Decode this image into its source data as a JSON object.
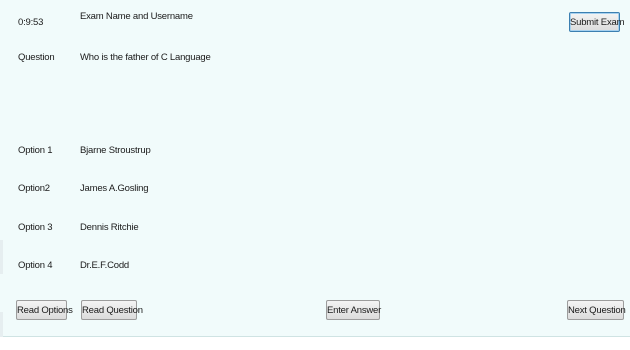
{
  "timer": "0:9:53",
  "header": {
    "exam_name": "Exam Name and Username",
    "submit_label": "Submit Exam"
  },
  "question": {
    "label": "Question",
    "text": "Who is the father of C Language"
  },
  "options": [
    {
      "label": "Option 1",
      "text": "Bjarne Stroustrup"
    },
    {
      "label": "Option2",
      "text": "James A.Gosling"
    },
    {
      "label": "Option 3",
      "text": "Dennis Ritchie"
    },
    {
      "label": "Option 4",
      "text": "Dr.E.F.Codd"
    }
  ],
  "controls": {
    "read_options": "Read Options",
    "read_question": "Read Question",
    "enter_answer": "Enter Answer",
    "next_question": "Next Question"
  }
}
